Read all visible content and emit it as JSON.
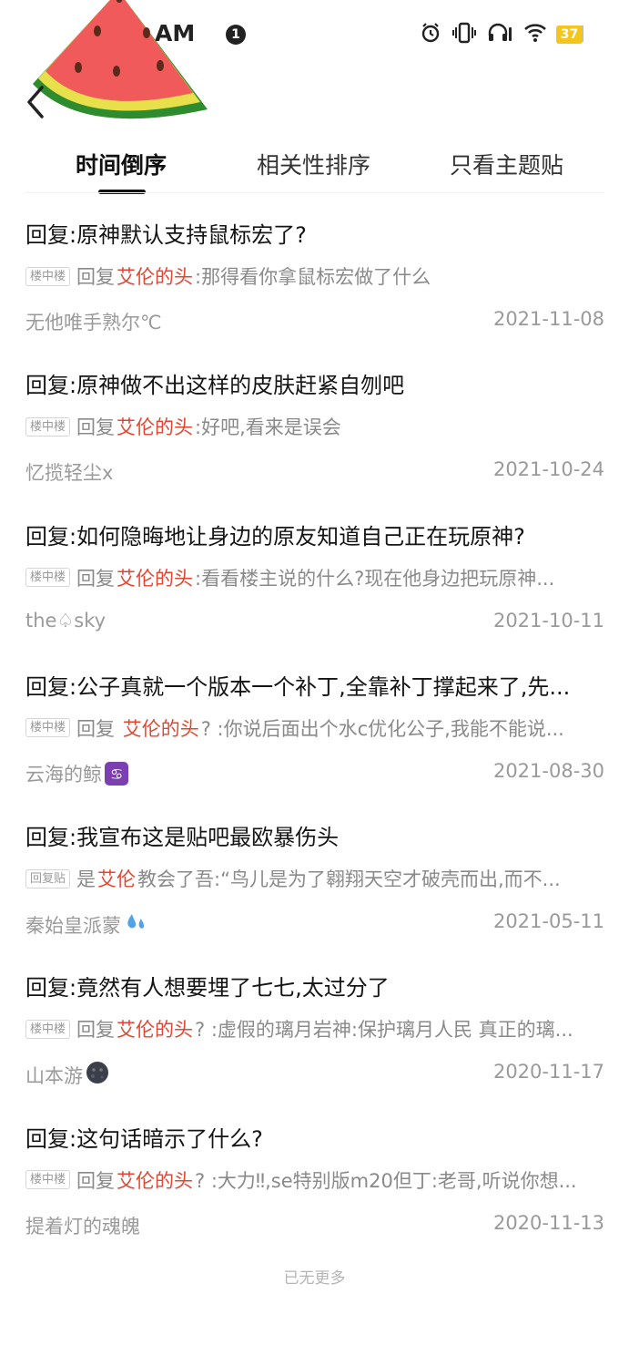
{
  "status_bar": {
    "time": "AM",
    "notification_count": "1",
    "battery": "37"
  },
  "tabs": [
    {
      "label": "时间倒序",
      "active": true
    },
    {
      "label": "相关性排序",
      "active": false
    },
    {
      "label": "只看主题贴",
      "active": false
    }
  ],
  "posts": [
    {
      "title": "回复:原神默认支持鼠标宏了?",
      "tag": "楼中楼",
      "reply_prefix": "回复",
      "reply_name": "艾伦的头",
      "reply_text": ":那得看你拿鼠标宏做了什么",
      "author": "无他唯手熟尔℃",
      "date": "2021-11-08"
    },
    {
      "title": "回复:原神做不出这样的皮肤赶紧自刎吧",
      "tag": "楼中楼",
      "reply_prefix": "回复",
      "reply_name": "艾伦的头",
      "reply_text": ":好吧,看来是误会",
      "author": "忆揽轻尘x",
      "date": "2021-10-24"
    },
    {
      "title": "回复:如何隐晦地让身边的原友知道自己正在玩原神?",
      "tag": "楼中楼",
      "reply_prefix": "回复",
      "reply_name": "艾伦的头",
      "reply_text": ":看看楼主说的什么?现在他身边把玩原神...",
      "author": "the♤sky",
      "date": "2021-10-11"
    },
    {
      "title": "回复:公子真就一个版本一个补丁,全靠补丁撑起来了,先...",
      "tag": "楼中楼",
      "reply_prefix": "回复 ",
      "reply_name": "艾伦的头",
      "reply_text": "? :你说后面出个水c优化公子,我能不能说...",
      "author": "云海的鲸",
      "author_icon": "cancer-zodiac-icon",
      "date": "2021-08-30"
    },
    {
      "title": "回复:我宣布这是贴吧最欧暴伤头",
      "tag": "回复贴",
      "reply_prefix": "是",
      "reply_name": "艾伦",
      "reply_text": "教会了吾:“鸟儿是为了翱翔天空才破壳而出,而不...",
      "author": "秦始皇派蒙",
      "author_icon": "sweat-droplets-icon",
      "date": "2021-05-11"
    },
    {
      "title": "回复:竟然有人想要埋了七七,太过分了",
      "tag": "楼中楼",
      "reply_prefix": "回复",
      "reply_name": "艾伦的头",
      "reply_text": "? :虚假的璃月岩神:保护璃月人民 真正的璃...",
      "author": "山本游",
      "author_icon": "new-moon-face-icon",
      "date": "2020-11-17"
    },
    {
      "title": "回复:这句话暗示了什么?",
      "tag": "楼中楼",
      "reply_prefix": "回复",
      "reply_name": "艾伦的头",
      "reply_text": "? :大力‼,se特别版m20但丁:老哥,听说你想...",
      "author": "提着灯的魂魄",
      "date": "2020-11-13"
    }
  ],
  "footer": {
    "no_more": "已无更多"
  },
  "colors": {
    "accent_red": "#e4452f",
    "battery_yellow": "#f6c51b"
  }
}
